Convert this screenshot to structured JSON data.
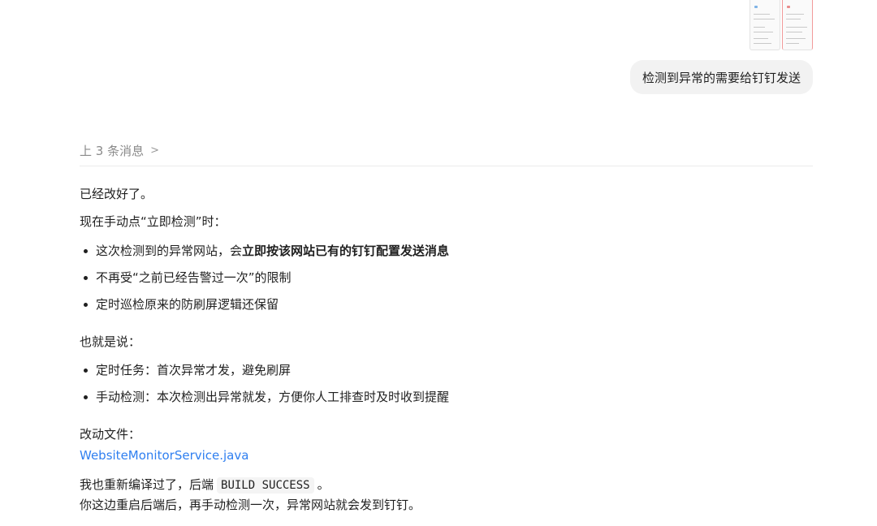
{
  "user_message": {
    "text": "检测到异常的需要给钉钉发送"
  },
  "history": {
    "previous_label": "上 3 条消息",
    "chevron_icon": "chevron-right-icon"
  },
  "reply": {
    "intro": "已经改好了。",
    "manual_lead": "现在手动点“立即检测”时：",
    "manual_points": [
      {
        "prefix": "这次检测到的异常网站，会",
        "bold": "立即按该网站已有的钉钉配置发送消息"
      },
      {
        "prefix": "不再受“之前已经告警过一次”的限制",
        "bold": ""
      },
      {
        "prefix": "定时巡检原来的防刷屏逻辑还保留",
        "bold": ""
      }
    ],
    "summary_lead": "也就是说：",
    "summary_points": [
      "定时任务：首次异常才发，避免刷屏",
      "手动检测：本次检测出异常就发，方便你人工排查时及时收到提醒"
    ],
    "files_label": "改动文件：",
    "file_link": "WebsiteMonitorService.java",
    "build_prefix": "我也重新编译过了，后端",
    "build_code": "BUILD SUCCESS",
    "build_suffix": "。",
    "closing": "你这边重启后端后，再手动检测一次，异常网站就会发到钉钉。"
  },
  "colors": {
    "link": "#2f7ff0",
    "bubble_bg": "#f2f2f2",
    "muted_text": "#8a8a8a"
  }
}
